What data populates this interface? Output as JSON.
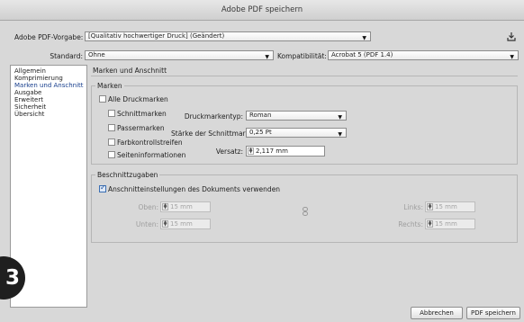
{
  "window": {
    "title": "Adobe PDF speichern"
  },
  "top": {
    "preset_label": "Adobe PDF-Vorgabe:",
    "preset_value": "[Qualitativ hochwertiger Druck] (Geändert)",
    "standard_label": "Standard:",
    "standard_value": "Ohne",
    "compat_label": "Kompatibilität:",
    "compat_value": "Acrobat 5 (PDF 1.4)"
  },
  "sidebar": {
    "items": [
      {
        "label": "Allgemein",
        "selected": false
      },
      {
        "label": "Komprimierung",
        "selected": false
      },
      {
        "label": "Marken und Anschnitt",
        "selected": true
      },
      {
        "label": "Ausgabe",
        "selected": false
      },
      {
        "label": "Erweitert",
        "selected": false
      },
      {
        "label": "Sicherheit",
        "selected": false
      },
      {
        "label": "Übersicht",
        "selected": false
      }
    ]
  },
  "panel": {
    "heading": "Marken und Anschnitt",
    "marks": {
      "title": "Marken",
      "all_marks": "Alle Druckmarken",
      "options": [
        "Schnittmarken",
        "Passermarken",
        "Farbkontrollstreifen",
        "Seiteninformationen"
      ],
      "type_label": "Druckmarkentyp:",
      "type_value": "Roman",
      "weight_label": "Stärke der Schnittmarke:",
      "weight_value": "0,25 Pt",
      "offset_label": "Versatz:",
      "offset_value": "2,117 mm"
    },
    "bleed": {
      "title": "Beschnittzugaben",
      "use_doc": "Anschnitteinstellungen des Dokuments verwenden",
      "use_doc_checked": true,
      "top_label": "Oben:",
      "top_value": "15 mm",
      "bottom_label": "Unten:",
      "bottom_value": "15 mm",
      "left_label": "Links:",
      "left_value": "15 mm",
      "right_label": "Rechts:",
      "right_value": "15 mm"
    }
  },
  "buttons": {
    "cancel": "Abbrechen",
    "save": "PDF speichern"
  },
  "badge": {
    "number": "3"
  }
}
